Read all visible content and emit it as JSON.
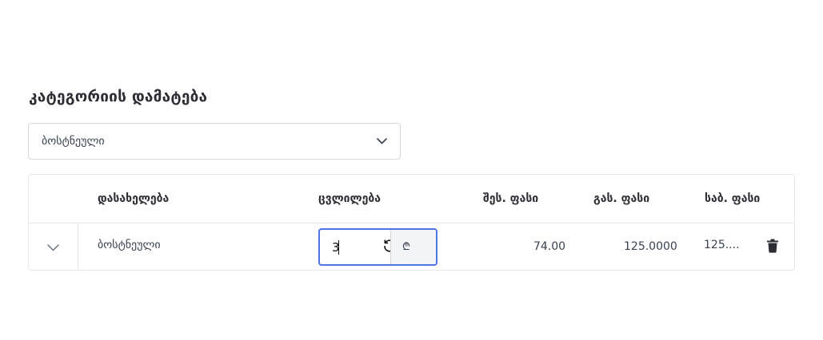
{
  "section": {
    "title": "კატეგორიის დამატება"
  },
  "category_select": {
    "value": "ბოსტნეული",
    "icon": "chevron-down-icon"
  },
  "table": {
    "headers": {
      "name": "დასახელება",
      "change": "ცვლილება",
      "buy_price": "შეს. ფასი",
      "sell_price": "გას. ფასი",
      "wholesale_price": "საბ. ფასი"
    },
    "rows": [
      {
        "name": "ბოსტნეული",
        "change_value": "3",
        "currency": "₾",
        "buy_price": "74.00",
        "sell_price": "125.0000",
        "wholesale_price": "125...."
      }
    ]
  },
  "colors": {
    "accent": "#4f74e3",
    "border": "#e5e7eb",
    "text": "#2d2d35"
  }
}
